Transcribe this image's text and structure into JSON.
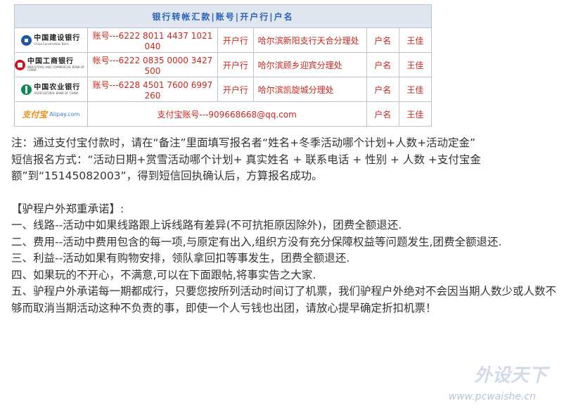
{
  "table": {
    "header": "银行转帐汇款|账号|开户行|户名",
    "rows": [
      {
        "logo_icon": "ccb-logo-icon",
        "logo_cn": "中国建设银行",
        "logo_en": "China Construction Bank",
        "account": "账号---6222 8011 4437 1021 040",
        "bank_label": "开户行",
        "branch": "哈尔滨新阳支行天合分理处",
        "name_label": "户名",
        "name": "王佳"
      },
      {
        "logo_icon": "icbc-logo-icon",
        "logo_cn": "中国工商银行",
        "logo_en": "INDUSTRIAL AND COMMERCIAL BANK OF CHINA",
        "account": "帐号---6222 0835 0000 3427 500",
        "bank_label": "开户行",
        "branch": "哈尔滨顾乡迎宾分理处",
        "name_label": "户名",
        "name": "王佳"
      },
      {
        "logo_icon": "abc-logo-icon",
        "logo_cn": "中国农业银行",
        "logo_en": "AGRICULTURAL BANK OF CHINA",
        "account": "账号---6228 4501 7600 6997 260",
        "bank_label": "开户行",
        "branch": "哈尔滨凯旋城分理处",
        "name_label": "户名",
        "name": "王佳"
      }
    ],
    "alipay": {
      "logo_icon": "alipay-logo-icon",
      "logo_cn": "支付宝",
      "logo_en": "Alipay.com",
      "account": "支付宝账号---909668668@qq.com",
      "name_label": "户名",
      "name": "王佳"
    }
  },
  "notes": {
    "note1": "注：通过支付宝付款时，请在“备注”里面填写报名者“姓名+冬季活动哪个计划+人数+活动定金”",
    "note2": "短信报名方式：“活动日期+赏雪活动哪个计划+ 真实姓名 + 联系电话 + 性别 + 人数 +支付宝金额”到“15145082003”，得到短信回执确认后，方算报名成功。"
  },
  "promise": {
    "title": "【驴程户外郑重承诺】:",
    "items": [
      "一、线路--活动中如果线路跟上诉线路有差异(不可抗拒原因除外)，团费全额退还.",
      "二、费用--活动中费用包含的每一项,与原定有出入,组织方没有充分保障权益等问题发生,团费全额退还.",
      "三、利益--活动如果有购物安排，领队拿回扣等事发生，团费全额退还.",
      "四、如果玩的不开心，不满意,可以在下面跟帖,将事实告之大家.",
      "五、驴程户外承诺每一期都成行，只要您按所列活动时间订了机票，我们驴程户外绝对不会因当期人数少或人数不够而取消当期活动这种不负责的事，即使一个人亏钱也出团，请放心提早确定折扣机票！"
    ]
  },
  "watermark": {
    "brand": "外设天下",
    "url": "www.pcwaishe.cn"
  }
}
